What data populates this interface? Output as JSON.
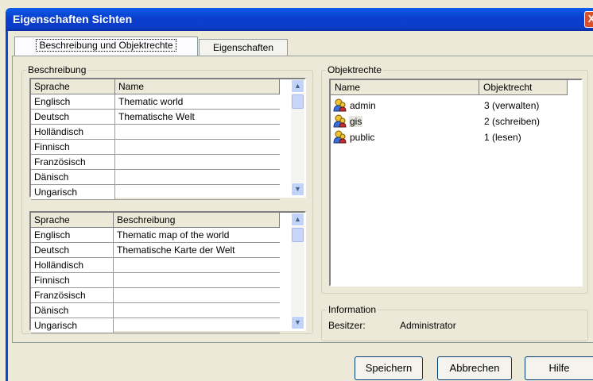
{
  "window": {
    "title": "Eigenschaften Sichten",
    "close_label": "X"
  },
  "tabs": [
    {
      "label": "Beschreibung und Objektrechte"
    },
    {
      "label": "Eigenschaften"
    }
  ],
  "beschreibung": {
    "group_label": "Beschreibung",
    "name_grid": {
      "headers": [
        "Sprache",
        "Name"
      ],
      "rows": [
        [
          "Englisch",
          "Thematic world"
        ],
        [
          "Deutsch",
          "Thematische Welt"
        ],
        [
          "Holländisch",
          ""
        ],
        [
          "Finnisch",
          ""
        ],
        [
          "Französisch",
          ""
        ],
        [
          "Dänisch",
          ""
        ],
        [
          "Ungarisch",
          ""
        ]
      ]
    },
    "desc_grid": {
      "headers": [
        "Sprache",
        "Beschreibung"
      ],
      "rows": [
        [
          "Englisch",
          "Thematic map of the world"
        ],
        [
          "Deutsch",
          "Thematische Karte der Welt"
        ],
        [
          "Holländisch",
          ""
        ],
        [
          "Finnisch",
          ""
        ],
        [
          "Französisch",
          ""
        ],
        [
          "Dänisch",
          ""
        ],
        [
          "Ungarisch",
          ""
        ]
      ]
    }
  },
  "objektrechte": {
    "group_label": "Objektrechte",
    "headers": [
      "Name",
      "Objektrecht"
    ],
    "rows": [
      {
        "icon": "user-group-icon",
        "name": "admin",
        "right": "3 (verwalten)"
      },
      {
        "icon": "user-group-icon",
        "name": "gis",
        "right": "2 (schreiben)",
        "selected": true
      },
      {
        "icon": "user-group-icon",
        "name": "public",
        "right": "1 (lesen)"
      }
    ]
  },
  "information": {
    "group_label": "Information",
    "owner_label": "Besitzer:",
    "owner_value": "Administrator"
  },
  "buttons": {
    "save": "Speichern",
    "cancel": "Abbrechen",
    "help": "Hilfe"
  },
  "colors": {
    "titlebar": "#0a46d6",
    "dialog_bg": "#ece9d8",
    "close": "#d9502b"
  }
}
